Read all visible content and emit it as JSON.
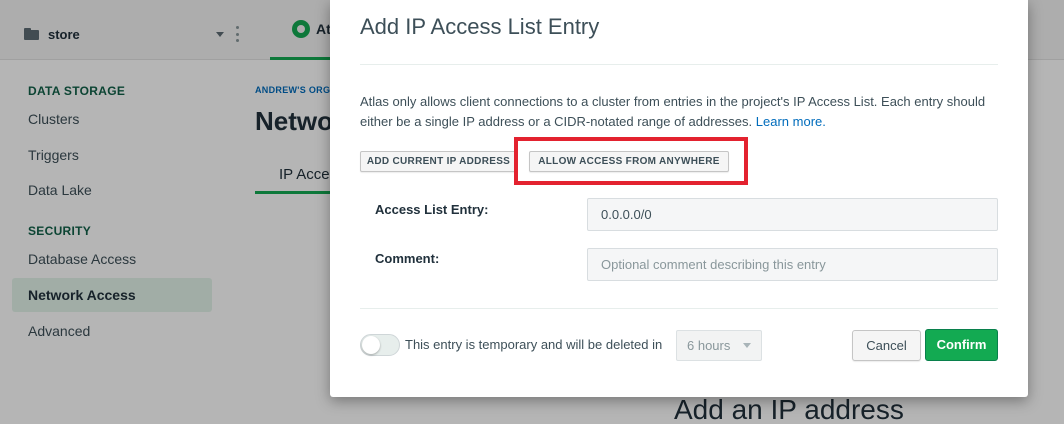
{
  "topbar": {
    "project_name": "store",
    "atlas_tab": "Atl"
  },
  "sidebar": {
    "data_storage_heading": "DATA STORAGE",
    "data_storage_items": [
      "Clusters",
      "Triggers",
      "Data Lake"
    ],
    "security_heading": "SECURITY",
    "security_items": [
      "Database Access",
      "Network Access",
      "Advanced"
    ],
    "active_item": "Network Access"
  },
  "main": {
    "org_crumb": "ANDREW'S ORG",
    "page_title": "Netwo",
    "tab_label": "IP Acce",
    "empty_title": "Add an IP address"
  },
  "modal": {
    "title": "Add IP Access List Entry",
    "description": "Atlas only allows client connections to a cluster from entries in the project's IP Access List. Each entry should either be a single IP address or a CIDR-notated range of addresses.",
    "learn_more": "Learn more.",
    "add_current_ip_label": "ADD CURRENT IP ADDRESS",
    "allow_anywhere_label": "ALLOW ACCESS FROM ANYWHERE",
    "access_list_label": "Access List Entry:",
    "access_list_value": "0.0.0.0/0",
    "comment_label": "Comment:",
    "comment_placeholder": "Optional comment describing this entry",
    "temporary_text": "This entry is temporary and will be deleted in",
    "hours_value": "6 hours",
    "cancel_label": "Cancel",
    "confirm_label": "Confirm"
  },
  "colors": {
    "accent_green": "#13aa52",
    "highlight_red": "#e3222f",
    "link_blue": "#006cbc"
  }
}
